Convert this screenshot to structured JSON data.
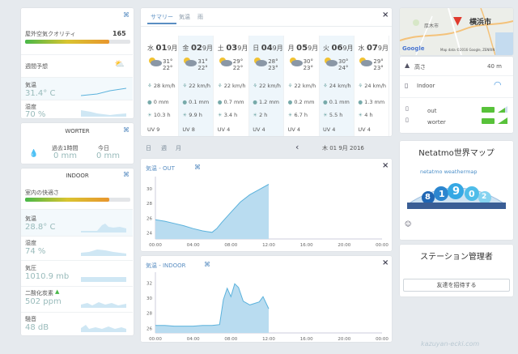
{
  "left": {
    "air_title": "屋外空気クオリティ",
    "air_value": "165",
    "forecast_label": "週間予想",
    "temp_label": "気温",
    "temp_value": "31.4° C",
    "hum_label": "湿度",
    "hum_value": "70 %",
    "rain_title": "WORTER",
    "rain_past_label": "過去1時間",
    "rain_past_value": "0 mm",
    "rain_today_label": "今日",
    "rain_today_value": "0 mm",
    "indoor_title": "INDOOR",
    "indoor_air": "室内の快適さ",
    "in_temp_label": "気温",
    "in_temp_value": "28.8° C",
    "in_hum_label": "湿度",
    "in_hum_value": "74 %",
    "in_press_label": "気圧",
    "in_press_value": "1010.9 mb",
    "in_co2_label": "二酸化炭素",
    "in_co2_value": "502 ppm",
    "in_noise_label": "騒音",
    "in_noise_value": "48 dB"
  },
  "forecast": {
    "tabs": [
      "サマリー",
      "気温",
      "雨"
    ],
    "days": [
      {
        "wd": "水",
        "date": "01",
        "unit": "9月",
        "hi": "31°",
        "lo": "22°",
        "wind": "28 km/h",
        "rain": "0 mm",
        "sun": "10.3 h",
        "uv": "UV",
        "uvv": "9"
      },
      {
        "wd": "金",
        "date": "02",
        "unit": "9月",
        "hi": "31°",
        "lo": "22°",
        "wind": "22 km/h",
        "rain": "0.1 mm",
        "sun": "9.9 h",
        "uv": "UV",
        "uvv": "8"
      },
      {
        "wd": "土",
        "date": "03",
        "unit": "9月",
        "hi": "29°",
        "lo": "22°",
        "wind": "22 km/h",
        "rain": "0.7 mm",
        "sun": "3.4 h",
        "uv": "UV",
        "uvv": "4"
      },
      {
        "wd": "日",
        "date": "04",
        "unit": "9月",
        "hi": "28°",
        "lo": "23°",
        "wind": "22 km/h",
        "rain": "1.2 mm",
        "sun": "2 h",
        "uv": "UV",
        "uvv": "4"
      },
      {
        "wd": "月",
        "date": "05",
        "unit": "9月",
        "hi": "30°",
        "lo": "23°",
        "wind": "22 km/h",
        "rain": "0.2 mm",
        "sun": "6.7 h",
        "uv": "UV",
        "uvv": "4"
      },
      {
        "wd": "火",
        "date": "06",
        "unit": "9月",
        "hi": "30°",
        "lo": "24°",
        "wind": "24 km/h",
        "rain": "0.1 mm",
        "sun": "5.5 h",
        "uv": "UV",
        "uvv": "4"
      },
      {
        "wd": "水",
        "date": "07",
        "unit": "9月",
        "hi": "29°",
        "lo": "23°",
        "wind": "24 km/h",
        "rain": "1.3 mm",
        "sun": "4 h",
        "uv": "UV",
        "uvv": "4"
      }
    ]
  },
  "period": {
    "tabs": [
      "日",
      "週",
      "月"
    ],
    "prev": "‹",
    "date": "木 01 9月 2016"
  },
  "chart_data": [
    {
      "type": "area",
      "title": "気温 -  OUT",
      "x_labels": [
        "00:00",
        "04:00",
        "08:00",
        "12:00",
        "16:00",
        "20:00",
        "00:00"
      ],
      "y_ticks": [
        "30",
        "28",
        "26",
        "24"
      ],
      "x": [
        0,
        1,
        2,
        3,
        4,
        5,
        6,
        6.5,
        7,
        8,
        9,
        10,
        11,
        12
      ],
      "y": [
        25.8,
        25.6,
        25.3,
        25.0,
        24.6,
        24.3,
        24.1,
        24.6,
        25.4,
        26.8,
        28.2,
        29.2,
        29.9,
        30.6
      ]
    },
    {
      "type": "area",
      "title": "気温 -  INDOOR",
      "x_labels": [
        "00:00",
        "04:00",
        "08:00",
        "12:00",
        "16:00",
        "20:00",
        "00:00"
      ],
      "y_ticks": [
        "32",
        "30",
        "28",
        "26"
      ],
      "x": [
        0,
        1,
        2,
        3,
        4,
        5,
        6,
        6.8,
        7.2,
        7.6,
        8,
        8.4,
        8.8,
        9.3,
        10,
        11,
        11.4,
        12
      ],
      "y": [
        26.4,
        26.4,
        26.3,
        26.3,
        26.3,
        26.4,
        26.4,
        26.5,
        29.8,
        31.3,
        30.2,
        31.9,
        31.4,
        29.6,
        29.1,
        29.5,
        30.2,
        28.6
      ]
    }
  ],
  "map": {
    "city1": "横浜市",
    "city2": "厚木市",
    "credit": "Map data ©2016 Google, ZENRIN",
    "google": "Google"
  },
  "station": {
    "alt_label": "高さ",
    "alt_value": "40 m",
    "indoor_label": "Indoor",
    "out_label": "out",
    "worter_label": "worter"
  },
  "world": {
    "title": "Netatmo世界マップ",
    "logo": "netatmo weathermap",
    "digits": [
      "8",
      "1",
      "9",
      "0",
      "2"
    ]
  },
  "manager": {
    "title": "ステーション管理者",
    "invite": "友達を招待する"
  },
  "colors": {
    "accent": "#5a8ec2",
    "fill": "#b9dcf0",
    "line": "#5bb2dc"
  },
  "watermark": "kazuyan-ecki.com"
}
